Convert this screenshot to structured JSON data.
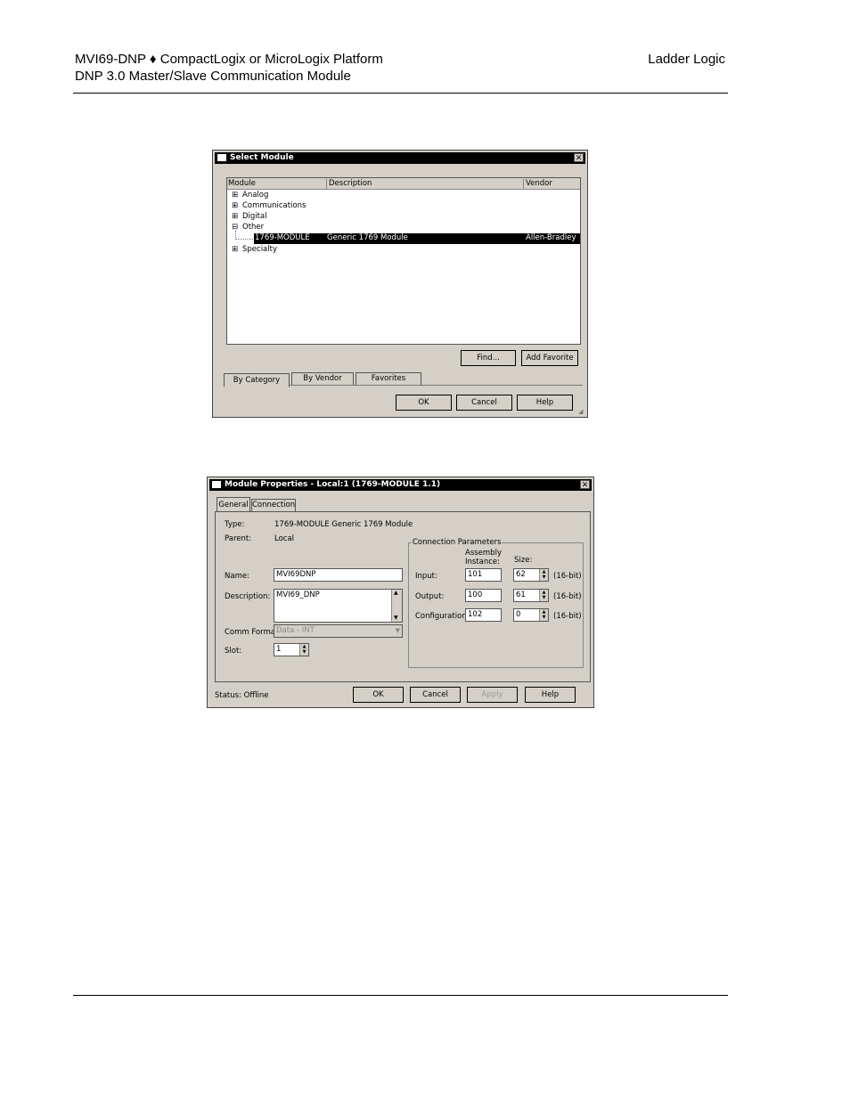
{
  "header": {
    "left_line1": "MVI69-DNP ♦ CompactLogix or MicroLogix Platform",
    "left_line2": "DNP 3.0 Master/Slave Communication Module",
    "right": "Ladder Logic"
  },
  "select_module": {
    "title": "Select Module",
    "columns": [
      "Module",
      "Description",
      "Vendor"
    ],
    "rows": [
      {
        "expander": "⊞",
        "module": "Analog",
        "description": "",
        "vendor": ""
      },
      {
        "expander": "⊞",
        "module": "Communications",
        "description": "",
        "vendor": ""
      },
      {
        "expander": "⊞",
        "module": "Digital",
        "description": "",
        "vendor": ""
      },
      {
        "expander": "⊟",
        "module": "Other",
        "description": "",
        "vendor": ""
      },
      {
        "expander": "",
        "module": "1769-MODULE",
        "description": "Generic 1769 Module",
        "vendor": "Allen-Bradley"
      },
      {
        "expander": "⊞",
        "module": "Specialty",
        "description": "",
        "vendor": ""
      }
    ],
    "find_label": "Find...",
    "add_favorite_label": "Add Favorite",
    "tabs": [
      "By Category",
      "By Vendor",
      "Favorites"
    ],
    "ok_label": "OK",
    "cancel_label": "Cancel",
    "help_label": "Help"
  },
  "module_properties": {
    "title": "Module Properties - Local:1 (1769-MODULE 1.1)",
    "tabs": [
      "General",
      "Connection"
    ],
    "type_label": "Type:",
    "type_value": "1769-MODULE Generic 1769 Module",
    "parent_label": "Parent:",
    "parent_value": "Local",
    "name_label": "Name:",
    "name_value": "MVI69DNP",
    "description_label": "Description:",
    "description_value": "MVI69_DNP",
    "comm_format_label": "Comm Format:",
    "comm_format_value": "Data - INT",
    "slot_label": "Slot:",
    "slot_value": "1",
    "conn_params_label": "Connection Parameters",
    "assembly_instance_label_1": "Assembly",
    "assembly_instance_label_2": "Instance:",
    "size_label": "Size:",
    "input_label": "Input:",
    "input_instance": "101",
    "input_size": "62",
    "output_label": "Output:",
    "output_instance": "100",
    "output_size": "61",
    "config_label": "Configuration:",
    "config_instance": "102",
    "config_size": "0",
    "unit_label": "(16-bit)",
    "status_text": "Status:  Offline",
    "ok_label": "OK",
    "cancel_label": "Cancel",
    "apply_label": "Apply",
    "help_label": "Help"
  }
}
